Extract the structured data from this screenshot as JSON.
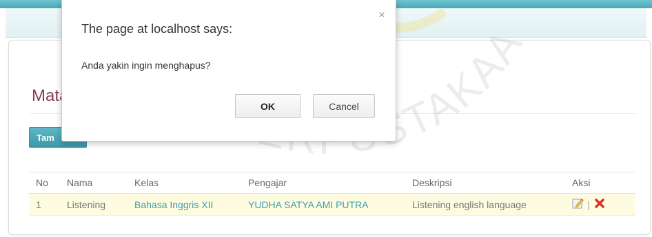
{
  "dialog": {
    "title": "The page at localhost says:",
    "message": "Anda yakin ingin menghapus?",
    "ok_label": "OK",
    "cancel_label": "Cancel",
    "close_glyph": "×"
  },
  "page": {
    "title_visible": "Mata",
    "add_button_visible": "Tam"
  },
  "table": {
    "headers": [
      "No",
      "Nama",
      "Kelas",
      "Pengajar",
      "Deskripsi",
      "Aksi"
    ],
    "rows": [
      {
        "no": "1",
        "nama": "Listening",
        "kelas": "Bahasa Inggris XII",
        "pengajar": "YUDHA SATYA AMI PUTRA",
        "deskripsi": "Listening english language",
        "separator": "|"
      }
    ]
  },
  "watermark": {
    "arc_text": "PUSAT PERPUSTAKAAN"
  },
  "colors": {
    "topbar": "#4aa9b8",
    "title": "#8a3c5f",
    "link": "#3a9db5",
    "row_highlight": "#fdfbe0",
    "delete_icon": "#d9362b"
  },
  "icons": {
    "edit": "edit-icon",
    "delete": "delete-icon",
    "close": "close-icon"
  }
}
